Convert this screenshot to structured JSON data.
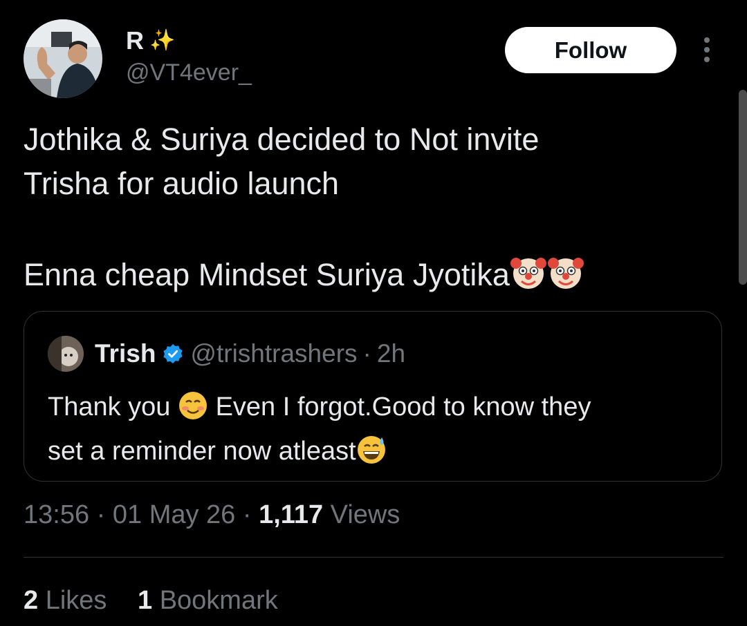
{
  "author": {
    "name": "R",
    "name_emoji": "✨",
    "handle": "@VT4ever_"
  },
  "follow_button_label": "Follow",
  "tweet": {
    "line1": "Jothika & Suriya decided to Not invite",
    "line2": "Trisha for audio launch",
    "line3": "Enna cheap Mindset Suriya Jyotika"
  },
  "quote": {
    "name": "Trish",
    "handle": "@trishtrashers",
    "separator": "·",
    "time": "2h",
    "text_part1": "Thank you",
    "text_part2": " Even I forgot.Good to know they",
    "text_line2": "set a reminder now atleast"
  },
  "meta": {
    "time": "13:56",
    "separator": "·",
    "date": "01 May 26",
    "views_count": "1,117",
    "views_label": "Views"
  },
  "stats": {
    "likes_count": "2",
    "likes_label": "Likes",
    "bookmarks_count": "1",
    "bookmarks_label": "Bookmark"
  },
  "colors": {
    "background": "#000000",
    "text": "#e7e9ea",
    "secondary": "#71767b",
    "verified": "#1d9bf0",
    "border": "#2f3336"
  }
}
